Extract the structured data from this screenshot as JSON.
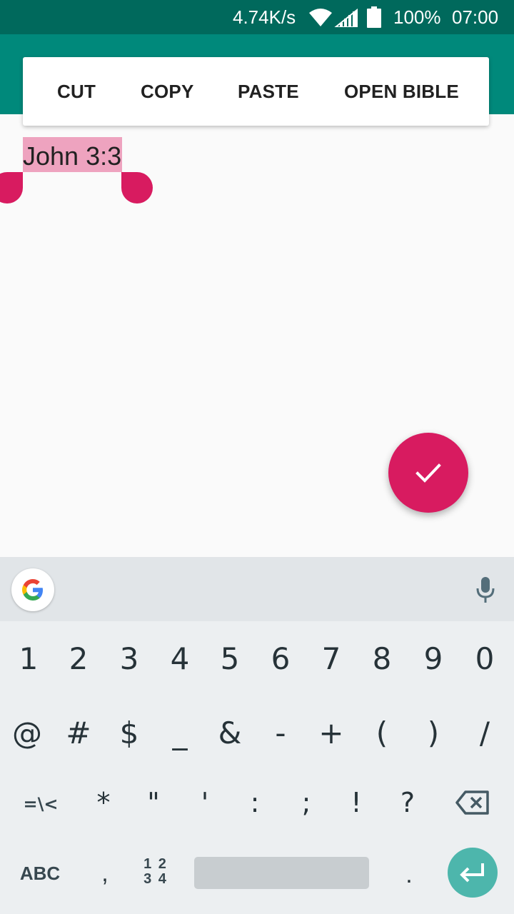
{
  "status_bar": {
    "net_speed": "4.74K/s",
    "battery": "100%",
    "time": "07:00"
  },
  "selection_toolbar": {
    "items": [
      "CUT",
      "COPY",
      "PASTE",
      "OPEN BIBLE"
    ]
  },
  "content": {
    "selected_text": "John 3:3"
  },
  "keyboard": {
    "row1": [
      "1",
      "2",
      "3",
      "4",
      "5",
      "6",
      "7",
      "8",
      "9",
      "0"
    ],
    "row2": [
      "@",
      "#",
      "$",
      "_",
      "&",
      "-",
      "+",
      "(",
      ")",
      "/"
    ],
    "row3": [
      "=\\<",
      "*",
      "\"",
      "'",
      ":",
      ";",
      "!",
      "?"
    ],
    "abc_label": "ABC",
    "comma": ",",
    "more_symbols_top": "1 2",
    "more_symbols_bottom": "3 4",
    "period": "."
  },
  "colors": {
    "status_bar": "#00695c",
    "app_bar": "#00897b",
    "accent": "#d81b60",
    "selection_highlight": "#eea3bf",
    "enter_key": "#4db6ac"
  },
  "icons": [
    "wifi-icon",
    "signal-icon",
    "battery-icon",
    "check-icon",
    "google-icon",
    "mic-icon",
    "backspace-icon",
    "enter-icon"
  ]
}
